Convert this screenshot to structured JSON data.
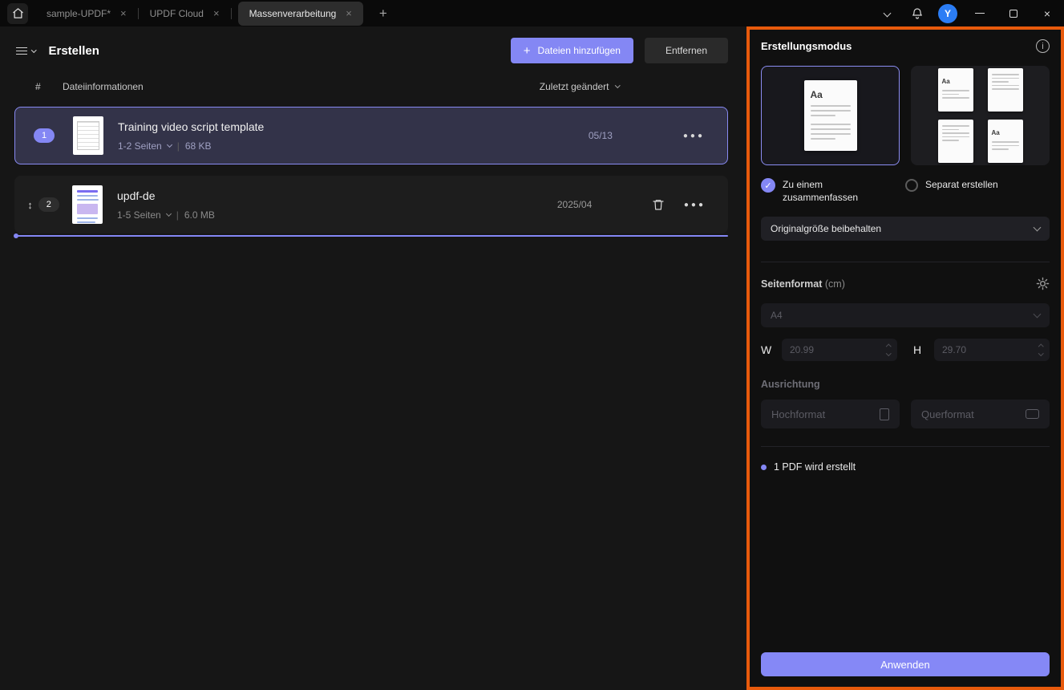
{
  "titlebar": {
    "tabs": [
      {
        "label": "sample-UPDF*"
      },
      {
        "label": "UPDF Cloud"
      },
      {
        "label": "Massenverarbeitung"
      }
    ],
    "avatar_initial": "Y"
  },
  "toolbar": {
    "title": "Erstellen",
    "add_files_label": "Dateien hinzufügen",
    "remove_label": "Entfernen"
  },
  "filelist": {
    "col_index": "#",
    "col_info": "Dateiinformationen",
    "col_modified": "Zuletzt geändert",
    "meta_separator": "|",
    "rows": [
      {
        "index": "1",
        "name": "Training video script template",
        "pages": "1-2 Seiten",
        "size": "68 KB",
        "modified": "05/13"
      },
      {
        "index": "2",
        "name": "updf-de",
        "pages": "1-5 Seiten",
        "size": "6.0 MB",
        "modified": "2025/04"
      }
    ]
  },
  "panel": {
    "title": "Erstellungsmodus",
    "preview_text": "Aa",
    "combine_label": "Zu einem zusammenfassen",
    "separate_label": "Separat erstellen",
    "size_mode": "Originalgröße beibehalten",
    "page_format_label": "Seitenformat",
    "page_format_unit": "(cm)",
    "paper_size": "A4",
    "width_label": "W",
    "width_value": "20.99",
    "height_label": "H",
    "height_value": "29.70",
    "orientation_label": "Ausrichtung",
    "portrait_label": "Hochformat",
    "landscape_label": "Querformat",
    "status_text": "1 PDF wird erstellt",
    "apply_label": "Anwenden"
  },
  "icons": {
    "plus": "+",
    "tab_close": "×",
    "dots": "●●●",
    "drag": "↕",
    "check": "✓",
    "info": "i"
  },
  "colors": {
    "accent": "#8487f4",
    "highlight_border": "#e85a0c",
    "avatar_bg": "#2b7df5",
    "selected_row_bg": "#333349"
  }
}
